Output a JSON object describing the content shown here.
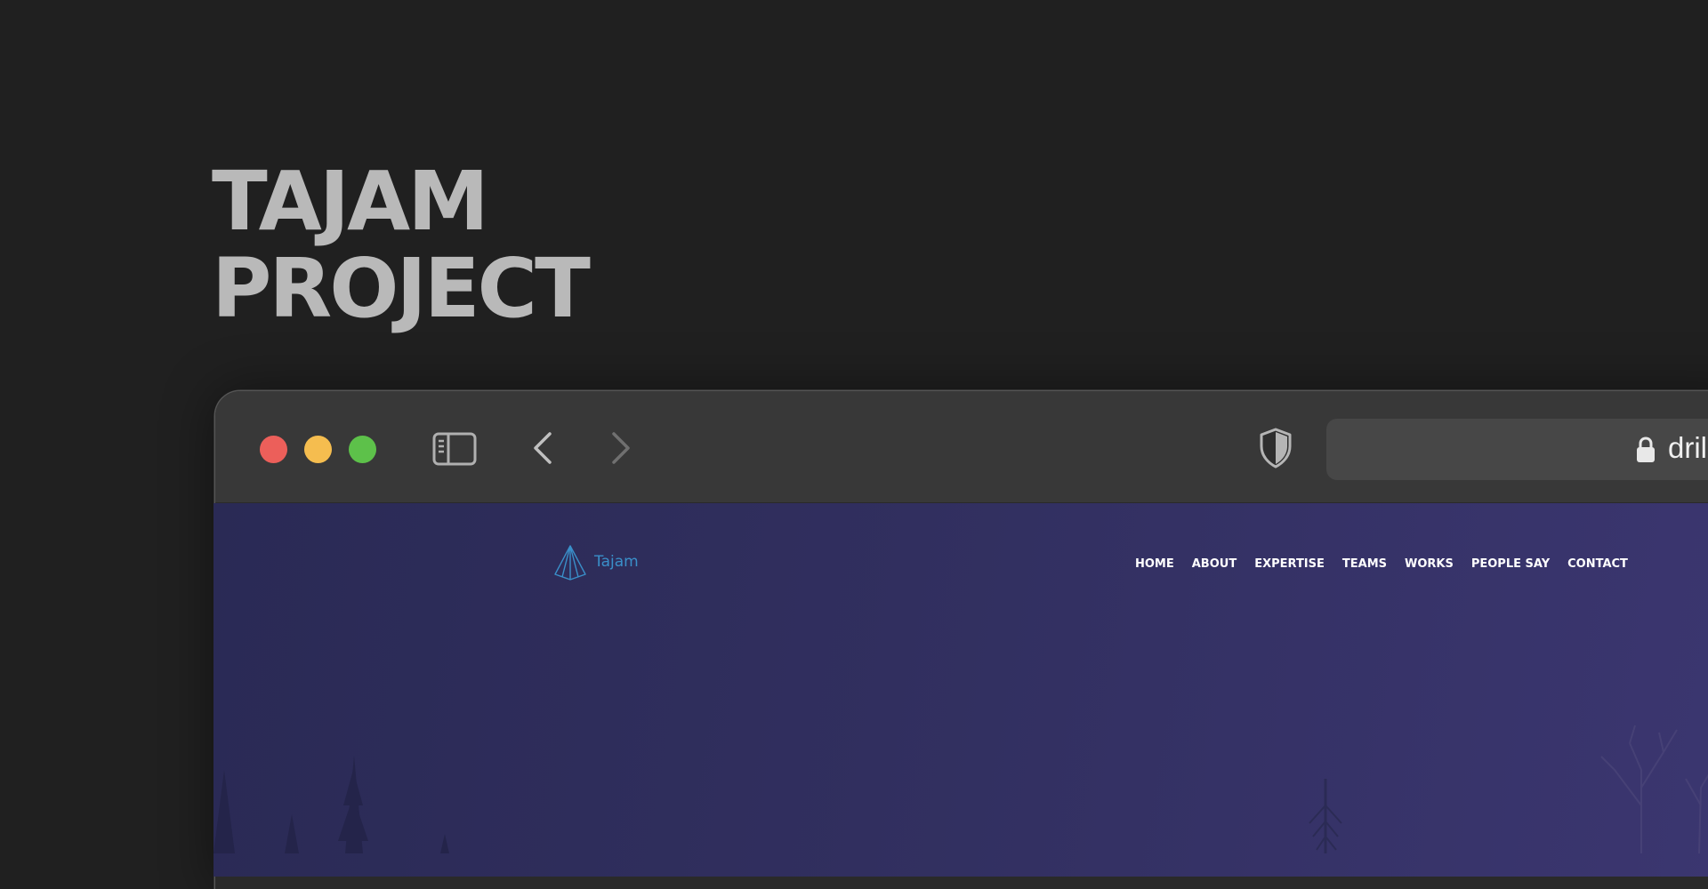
{
  "headline": {
    "line1": "TAJAM",
    "line2": "PROJECT"
  },
  "browser": {
    "traffic_lights": {
      "close_color": "#ec5f5a",
      "minimize_color": "#f5bd4f",
      "zoom_color": "#5dc14a"
    },
    "icons": [
      "sidebar-icon",
      "back-icon",
      "forward-icon",
      "shield-icon",
      "lock-icon"
    ],
    "address_text": "dril"
  },
  "website": {
    "logo_text": "Tajam",
    "nav": [
      "HOME",
      "ABOUT",
      "EXPERTISE",
      "TEAMS",
      "WORKS",
      "PEOPLE SAY",
      "CONTACT"
    ],
    "colors": {
      "logo": "#3a8fc9",
      "nav_text": "#ffffff",
      "hero_bg_start": "#2a2a55",
      "hero_bg_end": "#3b3670"
    }
  }
}
